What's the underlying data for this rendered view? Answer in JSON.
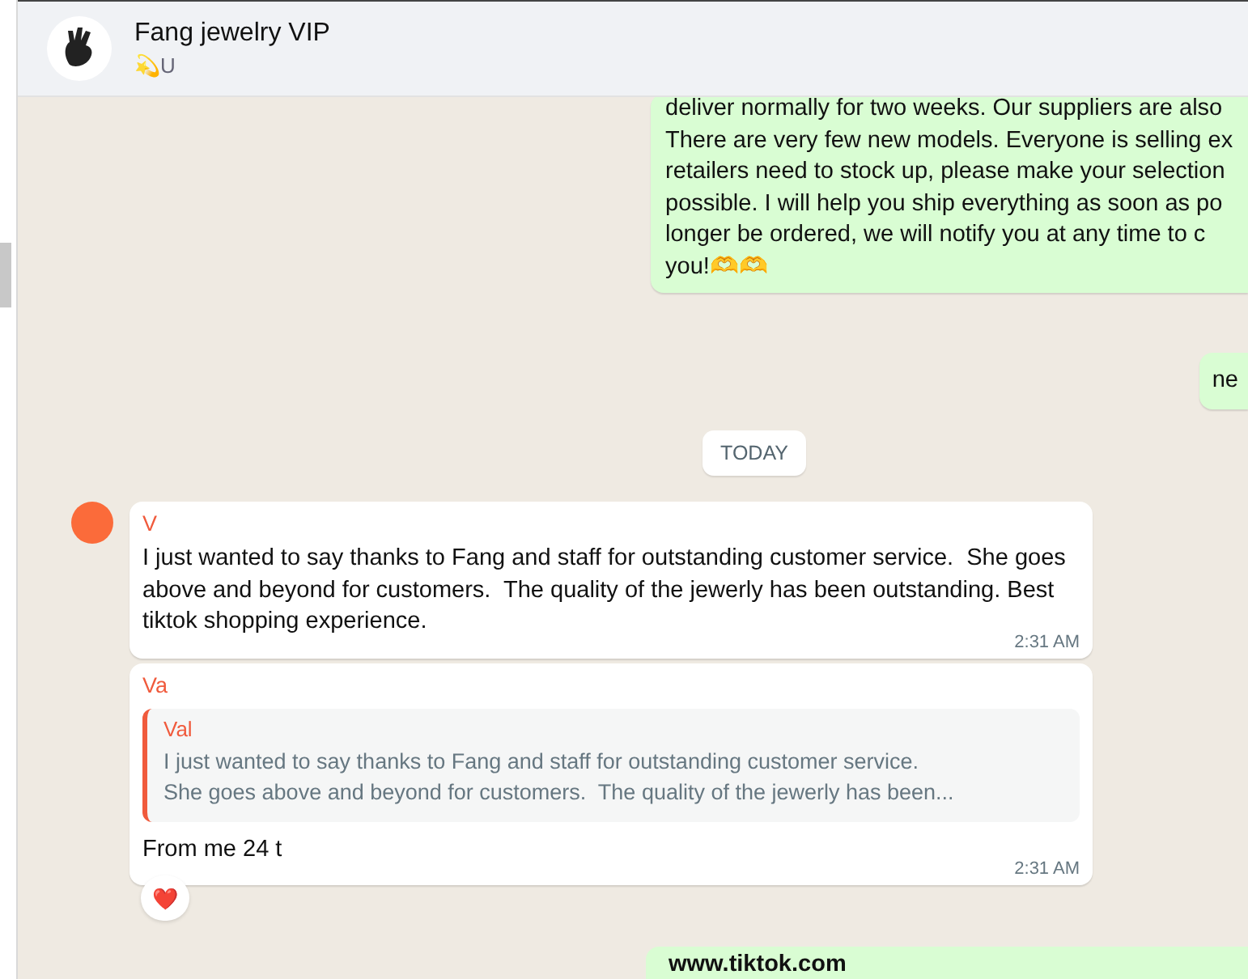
{
  "header": {
    "title": "Fang jewelry VIP",
    "subtitle": "💫U"
  },
  "messages": [
    {
      "kind": "outgoing",
      "lines": [
        "deliver normally for two weeks. Our suppliers are also",
        "There are very few new models. Everyone is selling ex",
        "retailers need to stock up, please make your selection",
        "possible. I will help you ship everything as soon as po",
        "longer be ordered, we will notify you at any time to c",
        "you!🫶🫶"
      ]
    },
    {
      "kind": "outgoing-short",
      "lines": [
        "ne"
      ]
    },
    {
      "kind": "date",
      "text": "TODAY"
    },
    {
      "kind": "incoming",
      "sender": "V",
      "text": "I just wanted to say thanks to Fang and staff for outstanding customer service.  She goes above and beyond for customers.  The quality of the jewerly has been outstanding. Best tiktok shopping experience.",
      "time": "2:31 AM"
    },
    {
      "kind": "reply",
      "sender": "Va",
      "quote_sender": "Val",
      "quote_lines": [
        "I just wanted to say thanks to Fang and staff for outstanding customer service.",
        "She goes above and beyond for customers.  The quality of the jewerly has been..."
      ],
      "text": "From me 24 t",
      "time": "2:31 AM",
      "reaction": "❤️"
    },
    {
      "kind": "link",
      "lines": [
        "www.tiktok.com"
      ]
    }
  ]
}
